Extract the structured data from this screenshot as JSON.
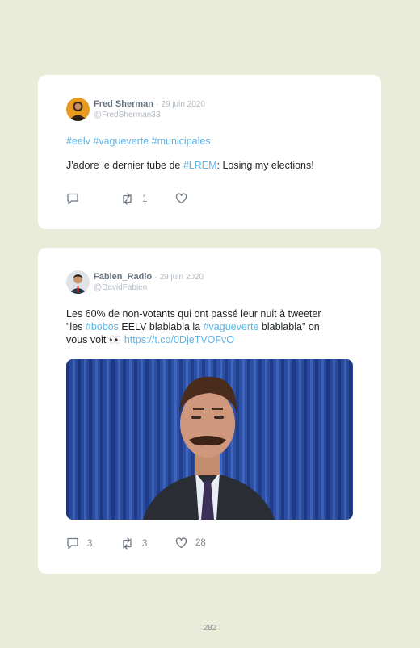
{
  "tweets": [
    {
      "display_name": "Fred Sherman",
      "separator": "·",
      "date": "29 juin 2020",
      "handle": "@FredSherman33",
      "hashtags_line": "#eelv #vagueverte #municipales",
      "text_before": "J'adore le dernier tube de ",
      "text_tag": "#LREM",
      "text_after": ": Losing my elections!",
      "replies": "",
      "retweets": "1",
      "likes": ""
    },
    {
      "display_name": "Fabien_Radio",
      "separator": "·",
      "date": "29 juin 2020",
      "handle": "@DavidFabien",
      "line1": "Les 60% de non-votants qui ont passé leur nuit à tweeter",
      "line2_a": "\"les ",
      "line2_tag1": "#bobos",
      "line2_b": " EELV blablabla la ",
      "line2_tag2": "#vagueverte",
      "line2_c": " blablabla\" on",
      "line3_a": "vous voit 👀 ",
      "line3_link": "https://t.co/0DjeTVOFvO",
      "replies": "3",
      "retweets": "3",
      "likes": "28"
    }
  ],
  "page_number": "282",
  "colors": {
    "background": "#e9ecd9",
    "link": "#5fb5e6",
    "muted": "#b3bac2"
  }
}
